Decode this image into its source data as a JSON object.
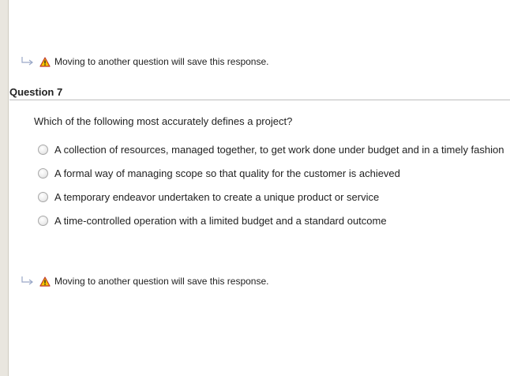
{
  "notices": {
    "top": "Moving to another question will save this response.",
    "bottom": "Moving to another question will save this response."
  },
  "question": {
    "title": "Question 7",
    "prompt": "Which of the following most accurately defines a project?",
    "options": [
      "A collection of resources, managed together, to get work done under budget and in a timely fashion",
      "A formal way of managing scope so that quality for the customer is achieved",
      "A temporary endeavor undertaken to create a unique product or service",
      "A time-controlled operation with a limited budget and a standard outcome"
    ]
  },
  "icons": {
    "arrow": "return-arrow-icon",
    "warning": "warning-icon"
  },
  "colors": {
    "warning_fill": "#f5c400",
    "warning_stroke": "#c0392b",
    "rail": "#e9e6df"
  }
}
